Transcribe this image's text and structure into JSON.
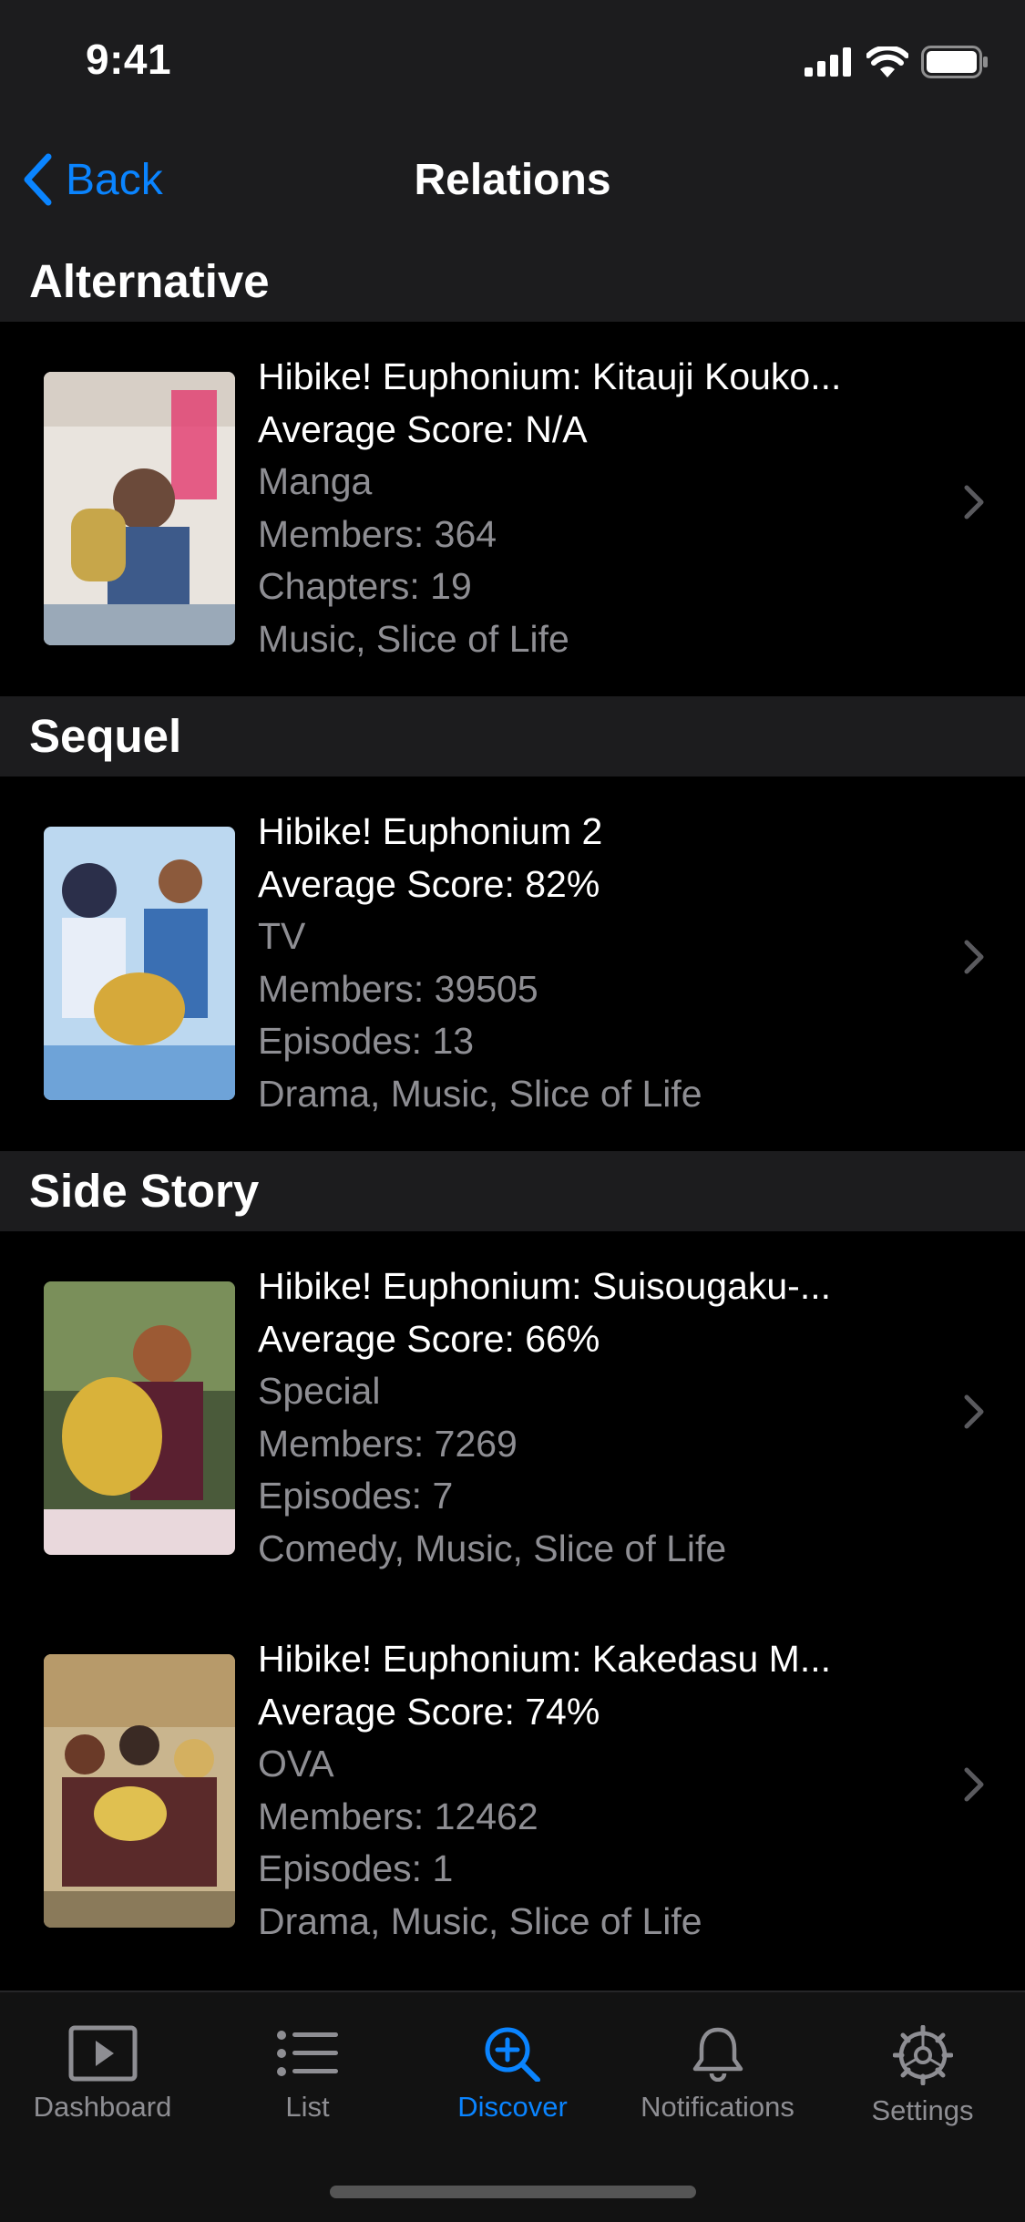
{
  "status": {
    "time": "9:41"
  },
  "nav": {
    "back_label": "Back",
    "title": "Relations"
  },
  "sections": [
    {
      "title": "Alternative",
      "items": [
        {
          "title": "Hibike! Euphonium: Kitauji Kouko...",
          "score": "Average Score: N/A",
          "format": "Manga",
          "members": "Members: 364",
          "count": "Chapters: 19",
          "genres": "Music, Slice of Life"
        }
      ]
    },
    {
      "title": "Sequel",
      "items": [
        {
          "title": "Hibike! Euphonium 2",
          "score": "Average Score: 82%",
          "format": "TV",
          "members": "Members: 39505",
          "count": "Episodes: 13",
          "genres": "Drama, Music, Slice of Life"
        }
      ]
    },
    {
      "title": "Side Story",
      "items": [
        {
          "title": "Hibike! Euphonium: Suisougaku-...",
          "score": "Average Score: 66%",
          "format": "Special",
          "members": "Members: 7269",
          "count": "Episodes: 7",
          "genres": "Comedy, Music, Slice of Life"
        },
        {
          "title": "Hibike! Euphonium: Kakedasu M...",
          "score": "Average Score: 74%",
          "format": "OVA",
          "members": "Members: 12462",
          "count": "Episodes: 1",
          "genres": "Drama, Music, Slice of Life"
        }
      ]
    }
  ],
  "tabs": [
    {
      "label": "Dashboard",
      "icon": "play-icon"
    },
    {
      "label": "List",
      "icon": "list-icon"
    },
    {
      "label": "Discover",
      "icon": "discover-icon",
      "active": true
    },
    {
      "label": "Notifications",
      "icon": "bell-icon"
    },
    {
      "label": "Settings",
      "icon": "gear-icon"
    }
  ],
  "colors": {
    "accent": "#0a84ff",
    "secondary_text": "#8e8e93",
    "section_bg": "#1c1c1e"
  }
}
